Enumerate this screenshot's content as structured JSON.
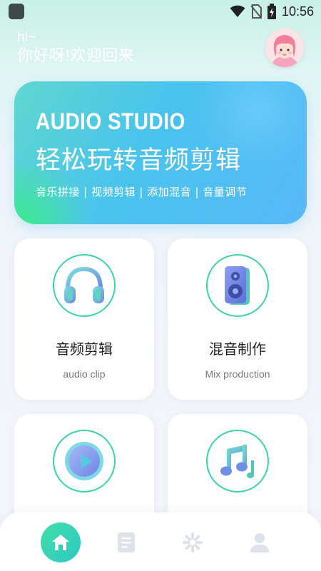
{
  "status_bar": {
    "time": "10:56"
  },
  "greeting": {
    "hi": "hi~",
    "message": "你好呀!欢迎回来"
  },
  "banner": {
    "title": "AUDIO STUDIO",
    "subtitle": "轻松玩转音频剪辑",
    "tags": "音乐拼接 | 视频剪辑 | 添加混音 | 音量调节"
  },
  "cards": [
    {
      "title": "音频剪辑",
      "subtitle": "audio clip",
      "icon": "headphones-icon"
    },
    {
      "title": "混音制作",
      "subtitle": "Mix production",
      "icon": "speaker-icon"
    },
    {
      "title": "",
      "subtitle": "",
      "icon": "play-icon"
    },
    {
      "title": "",
      "subtitle": "",
      "icon": "music-note-icon"
    }
  ],
  "tabs": [
    {
      "name": "home-icon",
      "active": true
    },
    {
      "name": "list-icon",
      "active": false
    },
    {
      "name": "sparkle-icon",
      "active": false
    },
    {
      "name": "user-icon",
      "active": false
    }
  ],
  "colors": {
    "accent": "#3cd3a6",
    "banner_start": "#3aed87",
    "banner_end": "#58b8f7",
    "tab_inactive": "#dde2ea"
  }
}
